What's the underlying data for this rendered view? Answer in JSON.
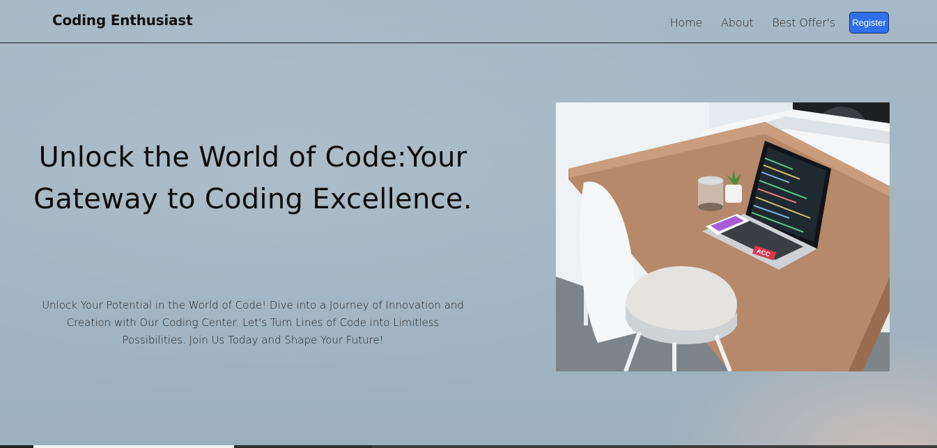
{
  "header": {
    "brand": "Coding Enthusiast",
    "nav": [
      {
        "label": "Home"
      },
      {
        "label": "About"
      },
      {
        "label": "Best Offer's"
      }
    ],
    "register_label": "Register"
  },
  "hero": {
    "title": "Unlock the World of Code:Your Gateway to Coding Excellence.",
    "subtitle": "Unlock Your Potential in the World of Code! Dive into a Journey of Innovation and Creation with Our Coding Center. Let's Turn Lines of Code into Limitless Possibilities. Join Us Today and Shape Your Future!",
    "image": {
      "icon": "desk-laptop-photo",
      "sticker_text": "ACC"
    }
  },
  "colors": {
    "register_bg": "#2f6fe8",
    "background": "#a3b6c3",
    "text": "#111111"
  }
}
